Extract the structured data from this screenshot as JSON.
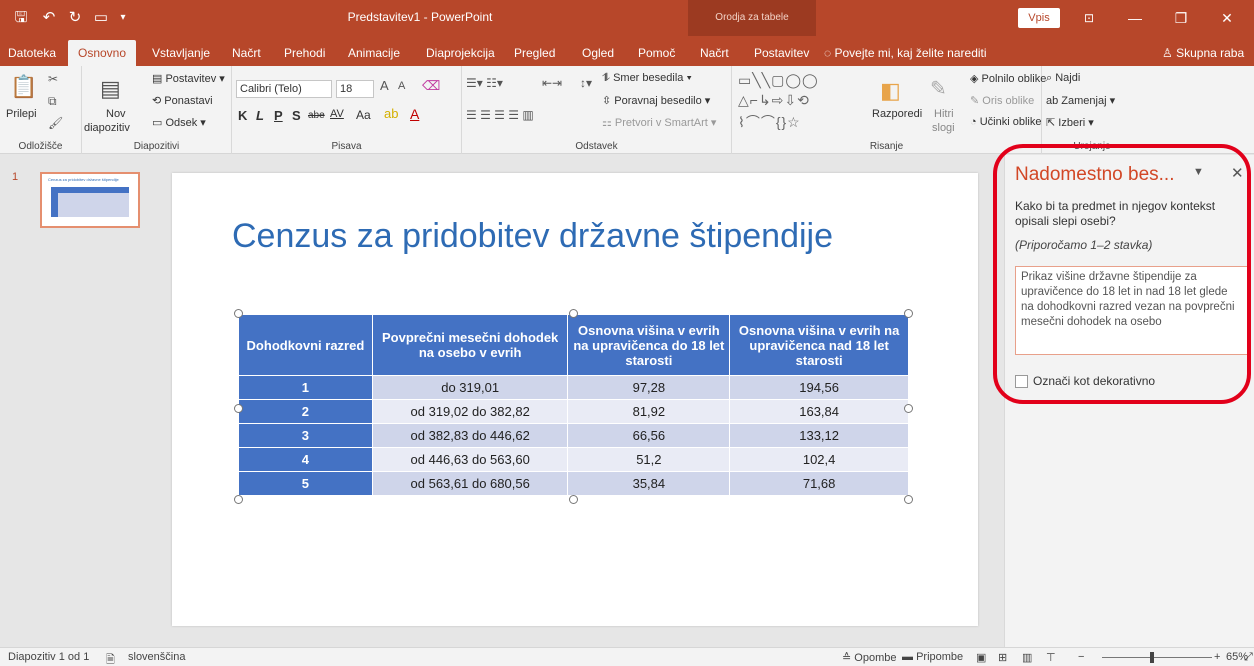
{
  "window": {
    "title": "Predstavitev1 - PowerPoint",
    "context_tab_group": "Orodja za tabele",
    "sign_in": "Vpis"
  },
  "tabs": [
    "Datoteka",
    "Osnovno",
    "Vstavljanje",
    "Načrt",
    "Prehodi",
    "Animacije",
    "Diaprojekcija",
    "Pregled",
    "Ogled",
    "Pomoč",
    "Načrt",
    "Postavitev"
  ],
  "active_tab": "Osnovno",
  "tell_me": "Povejte mi, kaj želite narediti",
  "share": "Skupna raba",
  "ribbon": {
    "clipboard": {
      "paste": "Prilepi",
      "label": "Odložišče"
    },
    "slides": {
      "new_slide_1": "Nov",
      "new_slide_2": "diapozitiv",
      "layout": "Postavitev",
      "reset": "Ponastavi",
      "section": "Odsek",
      "label": "Diapozitivi"
    },
    "font": {
      "font_name": "Calibri (Telo)",
      "font_size": "18",
      "bold": "K",
      "italic": "L",
      "underline": "P",
      "shadow": "S",
      "strike": "abe",
      "spacing": "AV",
      "case": "Aa",
      "label": "Pisava"
    },
    "paragraph": {
      "text_direction": "Smer besedila",
      "align_text": "Poravnaj besedilo",
      "smartart": "Pretvori v SmartArt",
      "label": "Odstavek"
    },
    "drawing": {
      "arrange": "Razporedi",
      "quick_styles_1": "Hitri",
      "quick_styles_2": "slogi",
      "fill": "Polnilo oblike",
      "outline": "Oris oblike",
      "effects": "Učinki oblike",
      "label": "Risanje"
    },
    "editing": {
      "find": "Najdi",
      "replace": "Zamenjaj",
      "select": "Izberi",
      "label": "Urejanje"
    }
  },
  "thumbnail": {
    "number": "1",
    "caption": "Cenzus za pridobitev državne štipendije"
  },
  "slide": {
    "title": "Cenzus za pridobitev državne štipendije",
    "table": {
      "headers": [
        "Dohodkovni razred",
        "Povprečni mesečni dohodek na osebo v evrih",
        "Osnovna višina v evrih na upravičenca do 18 let starosti",
        "Osnovna višina v evrih na upravičenca nad 18 let starosti"
      ],
      "rows": [
        [
          "1",
          "do 319,01",
          "97,28",
          "194,56"
        ],
        [
          "2",
          "od 319,02 do 382,82",
          "81,92",
          "163,84"
        ],
        [
          "3",
          "od 382,83 do 446,62",
          "66,56",
          "133,12"
        ],
        [
          "4",
          "od 446,63 do 563,60",
          "51,2",
          "102,4"
        ],
        [
          "5",
          "od 563,61 do 680,56",
          "35,84",
          "71,68"
        ]
      ]
    }
  },
  "alt_text_panel": {
    "title": "Nadomestno bes...",
    "question": "Kako bi ta predmet in njegov kontekst opisali slepi osebi?",
    "hint": "(Priporočamo 1–2 stavka)",
    "text": "Prikaz višine državne štipendije za upravičence do 18 let in nad 18 let glede na dohodkovni razred vezan na povprečni mesečni dohodek na osebo",
    "decorative_label": "Označi kot dekorativno",
    "decorative_checked": false
  },
  "status": {
    "slide_info": "Diapozitiv 1 od 1",
    "language": "slovenščina",
    "notes": "Opombe",
    "comments": "Pripombe",
    "zoom": "65%"
  },
  "colors": {
    "accent": "#b7472a",
    "table_header": "#4472c4",
    "highlight": "#e2001a"
  }
}
